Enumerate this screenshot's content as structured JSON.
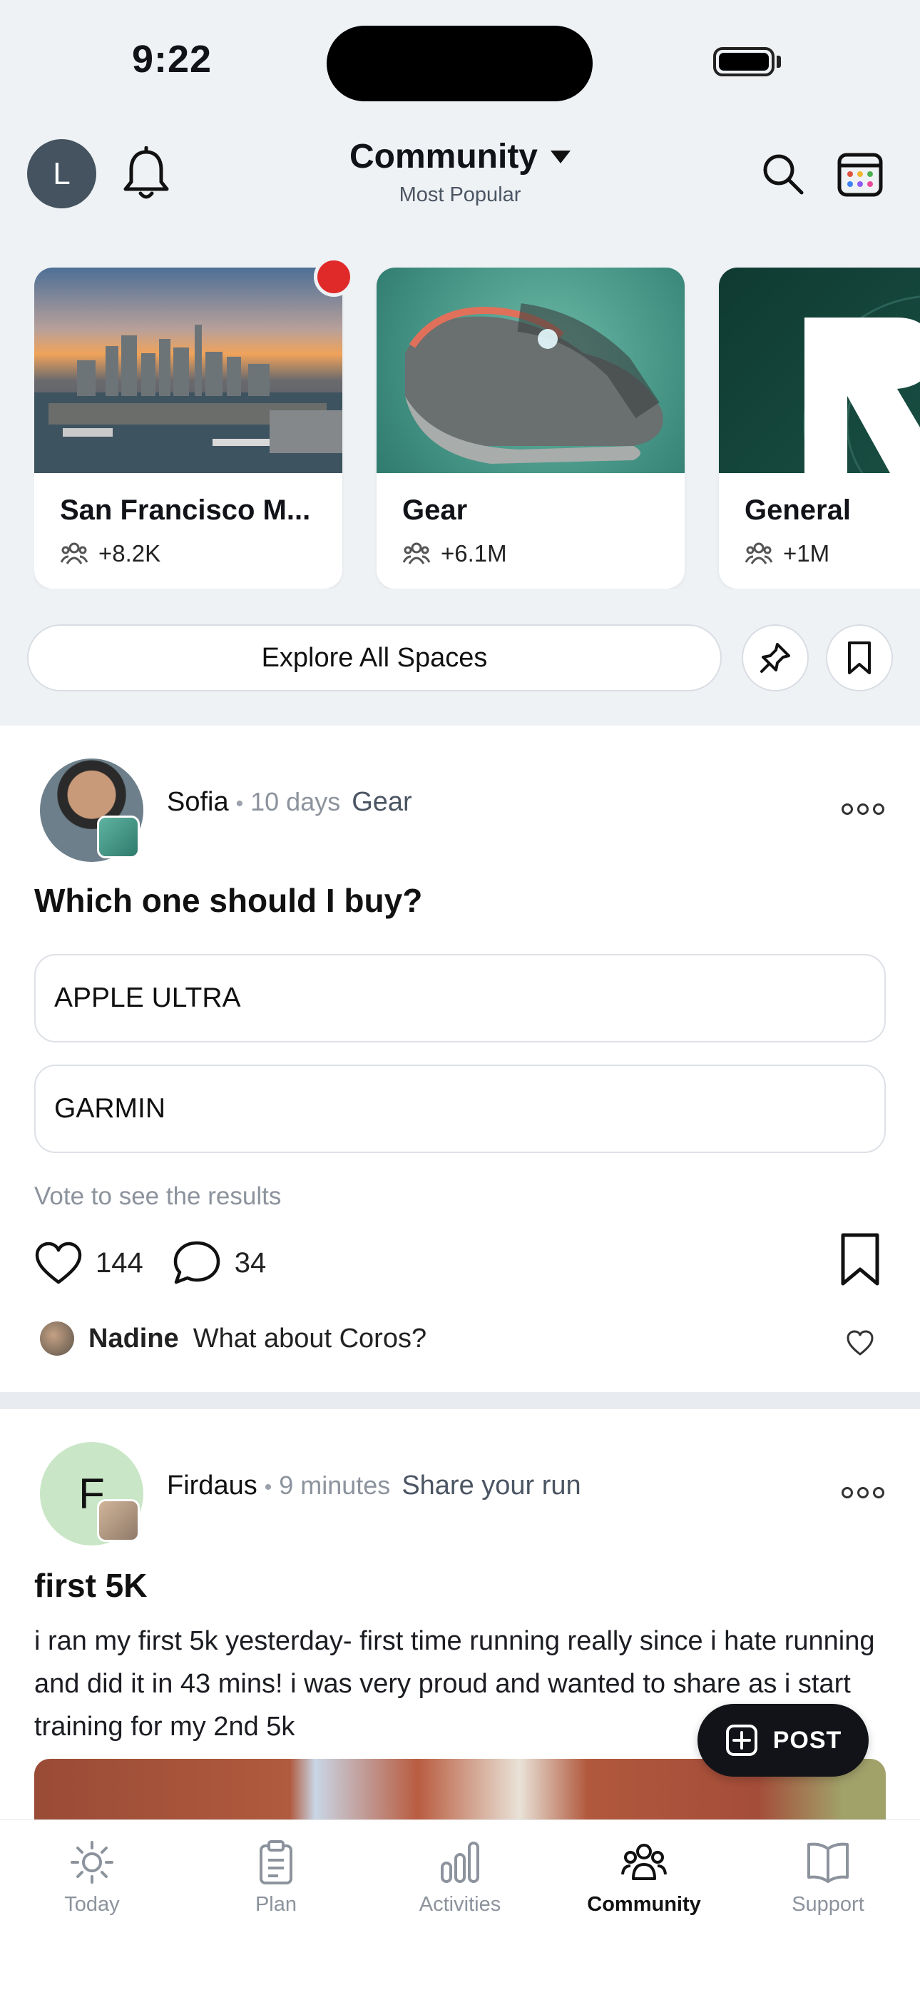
{
  "status_bar": {
    "time": "9:22"
  },
  "header": {
    "avatar_initial": "L",
    "title": "Community",
    "subtitle": "Most Popular"
  },
  "spaces": [
    {
      "name": "San Francisco M...",
      "members": "+8.2K",
      "has_notification": true
    },
    {
      "name": "Gear",
      "members": "+6.1M",
      "has_notification": false
    },
    {
      "name": "General",
      "members": "+1M",
      "has_notification": false
    }
  ],
  "explore": {
    "label": "Explore All Spaces"
  },
  "posts": [
    {
      "author": "Sofia",
      "time": "10 days",
      "space": "Gear",
      "title": "Which one should I buy?",
      "poll_options": [
        "APPLE ULTRA",
        "GARMIN"
      ],
      "poll_hint": "Vote to see the results",
      "likes": "144",
      "comments": "34",
      "top_comment": {
        "author": "Nadine",
        "text": "What about Coros?"
      }
    },
    {
      "author": "Firdaus",
      "author_initial": "F",
      "time": "9 minutes",
      "space": "Share your run",
      "title": "first 5K",
      "body": "i ran my first 5k yesterday- first time running really since i hate running and did it in 43 mins! i was very proud and wanted to share as i start training for my 2nd 5k"
    }
  ],
  "fab": {
    "label": "POST"
  },
  "tabs": [
    {
      "label": "Today",
      "icon": "sun-icon",
      "active": false
    },
    {
      "label": "Plan",
      "icon": "clipboard-icon",
      "active": false
    },
    {
      "label": "Activities",
      "icon": "bar-chart-icon",
      "active": false
    },
    {
      "label": "Community",
      "icon": "people-icon",
      "active": true
    },
    {
      "label": "Support",
      "icon": "book-icon",
      "active": false
    }
  ],
  "colors": {
    "background_top": "#eff2f5",
    "notification_red": "#e02a2a",
    "fab_bg": "#111318",
    "muted_text": "#8c939d"
  }
}
